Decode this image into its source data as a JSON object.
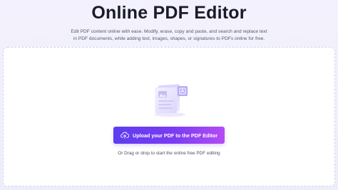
{
  "header": {
    "title": "Online PDF Editor",
    "subtitle_line1": "Edit PDF content online with ease. Modify, erase, copy and paste, and search and replace text",
    "subtitle_line2": "in PDF documents, while adding text, images, shapes, or signatures to PDFs online for free."
  },
  "upload": {
    "button_label": "Upload your PDF to the PDF Editor",
    "button_icon": "cloud-upload-icon",
    "illustration_icon": "pdf-document-illustration-icon",
    "drag_hint": "Or Drag or drop to start the online free PDF editing"
  },
  "colors": {
    "button_gradient_start": "#5e3df0",
    "button_gradient_end": "#b44cf5",
    "accent_light": "#c9c2f7",
    "background": "#f1f0fb"
  }
}
